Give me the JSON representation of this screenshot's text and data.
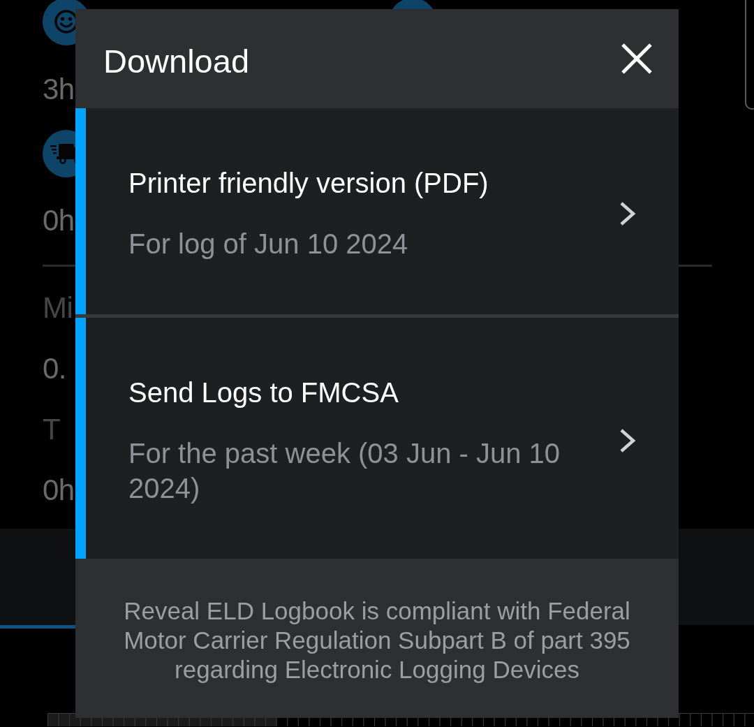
{
  "background": {
    "stats": [
      {
        "kind": "value",
        "text": "3h"
      },
      {
        "kind": "value",
        "text": "0h"
      },
      {
        "kind": "label",
        "text": "Mi"
      },
      {
        "kind": "value",
        "text": "0."
      },
      {
        "kind": "label",
        "text": "T"
      },
      {
        "kind": "value",
        "text": "0h"
      }
    ]
  },
  "dialog": {
    "title": "Download",
    "options": [
      {
        "title": "Printer friendly version (PDF)",
        "subtitle": "For log of Jun 10 2024"
      },
      {
        "title": "Send Logs to FMCSA",
        "subtitle": "For the past week (03 Jun - Jun 10 2024)"
      }
    ],
    "footer_note": "Reveal ELD Logbook is compliant with Federal Motor Carrier Regulation Subpart B of part 395 regarding Electronic Logging Devices"
  }
}
